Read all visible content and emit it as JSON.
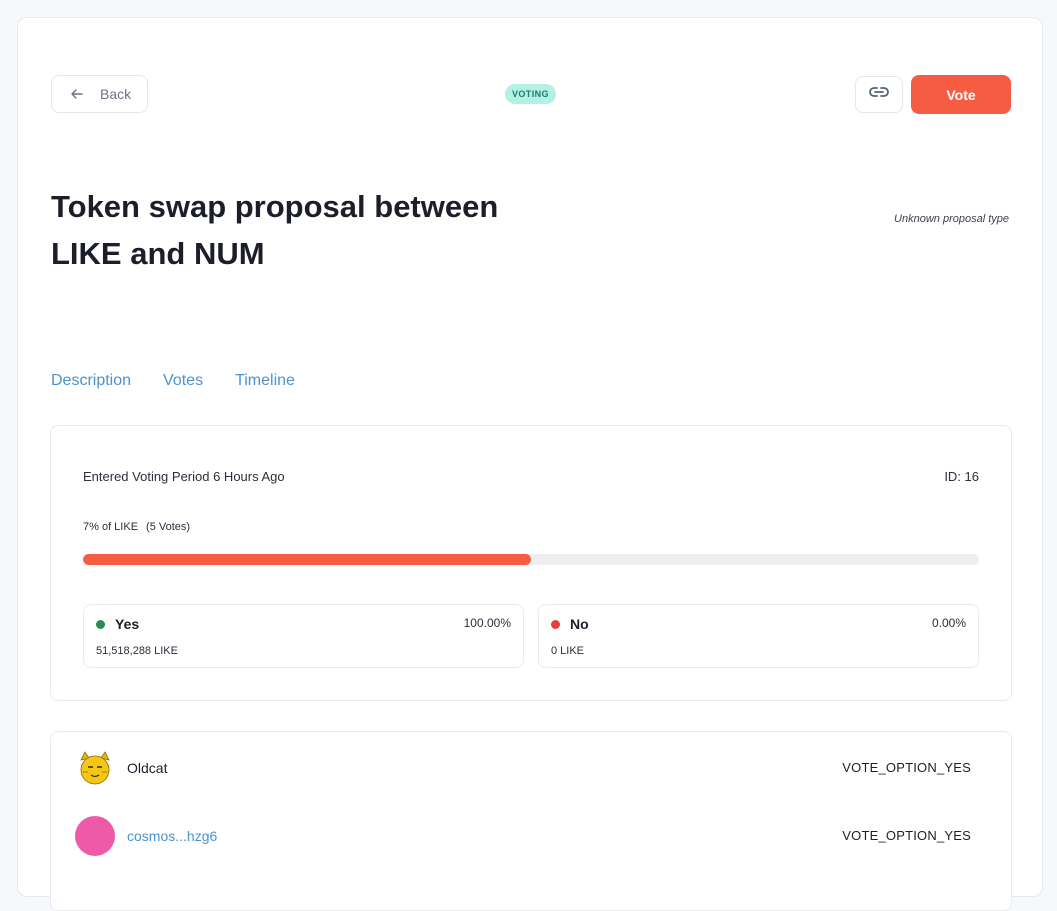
{
  "header": {
    "back_label": "Back",
    "status": "VOTING",
    "vote_label": "Vote"
  },
  "proposal": {
    "title": "Token swap proposal between LIKE and NUM",
    "type": "Unknown proposal type"
  },
  "tabs": [
    {
      "label": "Description"
    },
    {
      "label": "Votes"
    },
    {
      "label": "Timeline"
    }
  ],
  "tally": {
    "period_text": "Entered Voting Period 6 Hours Ago",
    "id_text": "ID: 16",
    "turnout_label": "7% of LIKE",
    "votes_count_label": "(5 Votes)",
    "progress_fraction": 0.5,
    "options": [
      {
        "label": "Yes",
        "percent": "100.00%",
        "amount": "51,518,288 LIKE",
        "color": "#2e8b57"
      },
      {
        "label": "No",
        "percent": "0.00%",
        "amount": "0 LIKE",
        "color": "#e5403a"
      }
    ]
  },
  "votes": [
    {
      "voter": "Oldcat",
      "option": "VOTE_OPTION_YES",
      "avatar": "cat-avatar"
    },
    {
      "voter": "cosmos...hzg6",
      "option": "VOTE_OPTION_YES",
      "avatar": "pink-circle-avatar",
      "avatar_color": "#ee5aa7"
    }
  ],
  "colors": {
    "accent": "#f65c43",
    "link": "#4b93cf",
    "badge_bg": "#b3f1e6",
    "badge_text": "#207a6b"
  }
}
